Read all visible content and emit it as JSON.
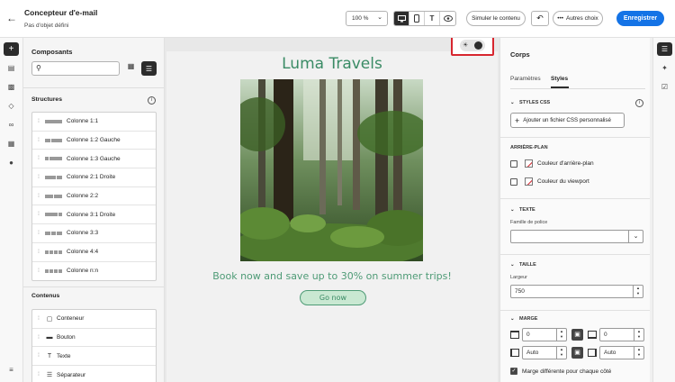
{
  "header": {
    "title": "Concepteur d'e-mail",
    "subtitle": "Pas d'objet défini",
    "zoom": "100 %",
    "simulate_label": "Simuler le contenu",
    "more_label": "Autres choix",
    "save_label": "Enregistrer",
    "view_modes": [
      "desktop",
      "mobile",
      "text",
      "preview"
    ],
    "active_view": "desktop"
  },
  "components": {
    "title": "Composants",
    "search_placeholder": "",
    "structures_title": "Structures",
    "structures": [
      {
        "label": "Colonne 1:1",
        "cols": [
          1
        ]
      },
      {
        "label": "Colonne 1:2 Gauche",
        "cols": [
          1,
          2
        ]
      },
      {
        "label": "Colonne 1:3 Gauche",
        "cols": [
          1,
          3
        ]
      },
      {
        "label": "Colonne 2:1 Droite",
        "cols": [
          2,
          1
        ]
      },
      {
        "label": "Colonne 2:2",
        "cols": [
          1,
          1
        ]
      },
      {
        "label": "Colonne 3:1 Droite",
        "cols": [
          3,
          1
        ]
      },
      {
        "label": "Colonne 3:3",
        "cols": [
          1,
          1,
          1
        ]
      },
      {
        "label": "Colonne 4:4",
        "cols": [
          1,
          1,
          1,
          1
        ]
      },
      {
        "label": "Colonne n:n",
        "cols": [
          1,
          1,
          1,
          1
        ]
      }
    ],
    "contents_title": "Contenus",
    "contents": [
      {
        "label": "Conteneur",
        "icon": "container-icon"
      },
      {
        "label": "Bouton",
        "icon": "button-icon"
      },
      {
        "label": "Texte",
        "icon": "text-icon"
      },
      {
        "label": "Séparateur",
        "icon": "divider-icon"
      }
    ]
  },
  "email": {
    "title": "Luma Travels",
    "promo": "Book now and save up to 30% on summer trips!",
    "cta": "Go now",
    "brand_color": "#3a8b65"
  },
  "props": {
    "title": "Corps",
    "tabs": [
      "Paramètres",
      "Styles"
    ],
    "active_tab": "Styles",
    "css_section": "STYLES CSS",
    "css_button": "Ajouter un fichier CSS personnalisé",
    "bg_section": "ARRIÈRE-PLAN",
    "bg_color_label": "Couleur d'arrière-plan",
    "viewport_color_label": "Couleur du viewport",
    "text_section": "TEXTE",
    "font_family_label": "Famille de police",
    "font_family_value": "",
    "size_section": "TAILLE",
    "width_label": "Largeur",
    "width_value": "750",
    "margin_section": "MARGE",
    "margin_top": "0",
    "margin_bottom": "0",
    "margin_left": "Auto",
    "margin_right": "Auto",
    "margin_per_side_label": "Marge différente pour chaque côté",
    "margin_per_side_checked": true
  }
}
